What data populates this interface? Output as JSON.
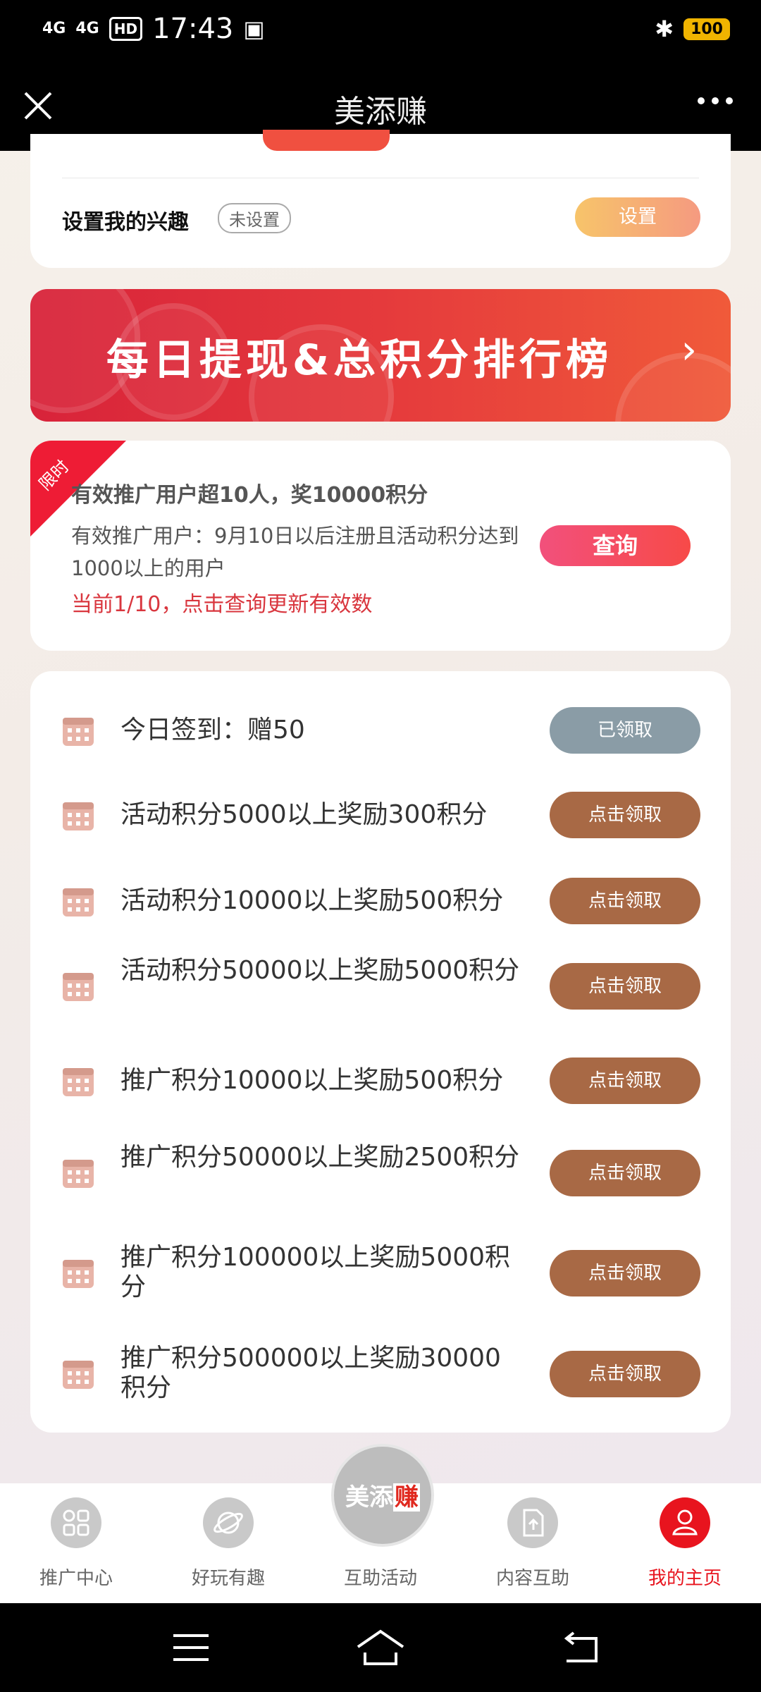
{
  "status_bar": {
    "signal1": "4G",
    "signal2": "4G",
    "hd": "HD",
    "time": "17:43",
    "battery": "100"
  },
  "nav": {
    "title": "美添赚"
  },
  "interest": {
    "label": "设置我的兴趣",
    "status": "未设置",
    "button": "设置"
  },
  "banner": {
    "text": "每日提现&总积分排行榜"
  },
  "promo": {
    "ribbon": "限时",
    "title": "有效推广用户超10人，奖10000积分",
    "desc": "有效推广用户：9月10日以后注册且活动积分达到1000以上的用户",
    "status": "当前1/10，点击查询更新有效数",
    "button": "查询"
  },
  "tasks": [
    {
      "label": "今日签到：赠50",
      "button": "已领取"
    },
    {
      "label": "活动积分5000以上奖励300积分",
      "button": "点击领取"
    },
    {
      "label": "活动积分10000以上奖励500积分",
      "button": "点击领取"
    },
    {
      "label": "活动积分50000以上奖励5000积分",
      "button": "点击领取"
    },
    {
      "label": "推广积分10000以上奖励500积分",
      "button": "点击领取"
    },
    {
      "label": "推广积分50000以上奖励2500积分",
      "button": "点击领取"
    },
    {
      "label": "推广积分100000以上奖励5000积分",
      "button": "点击领取"
    },
    {
      "label": "推广积分500000以上奖励30000积分",
      "button": "点击领取"
    }
  ],
  "tabbar": {
    "center_logo": {
      "part1": "美添",
      "part2": "赚"
    },
    "tabs": [
      {
        "label": "推广中心",
        "icon": "grid-icon"
      },
      {
        "label": "好玩有趣",
        "icon": "planet-icon"
      },
      {
        "label": "互助活动",
        "icon": "logo-icon"
      },
      {
        "label": "内容互助",
        "icon": "upload-doc-icon"
      },
      {
        "label": "我的主页",
        "icon": "user-icon"
      }
    ]
  },
  "colors": {
    "accent": "#e8141e",
    "claim_button": "#a86945",
    "claimed_button": "#8a9ca6"
  }
}
